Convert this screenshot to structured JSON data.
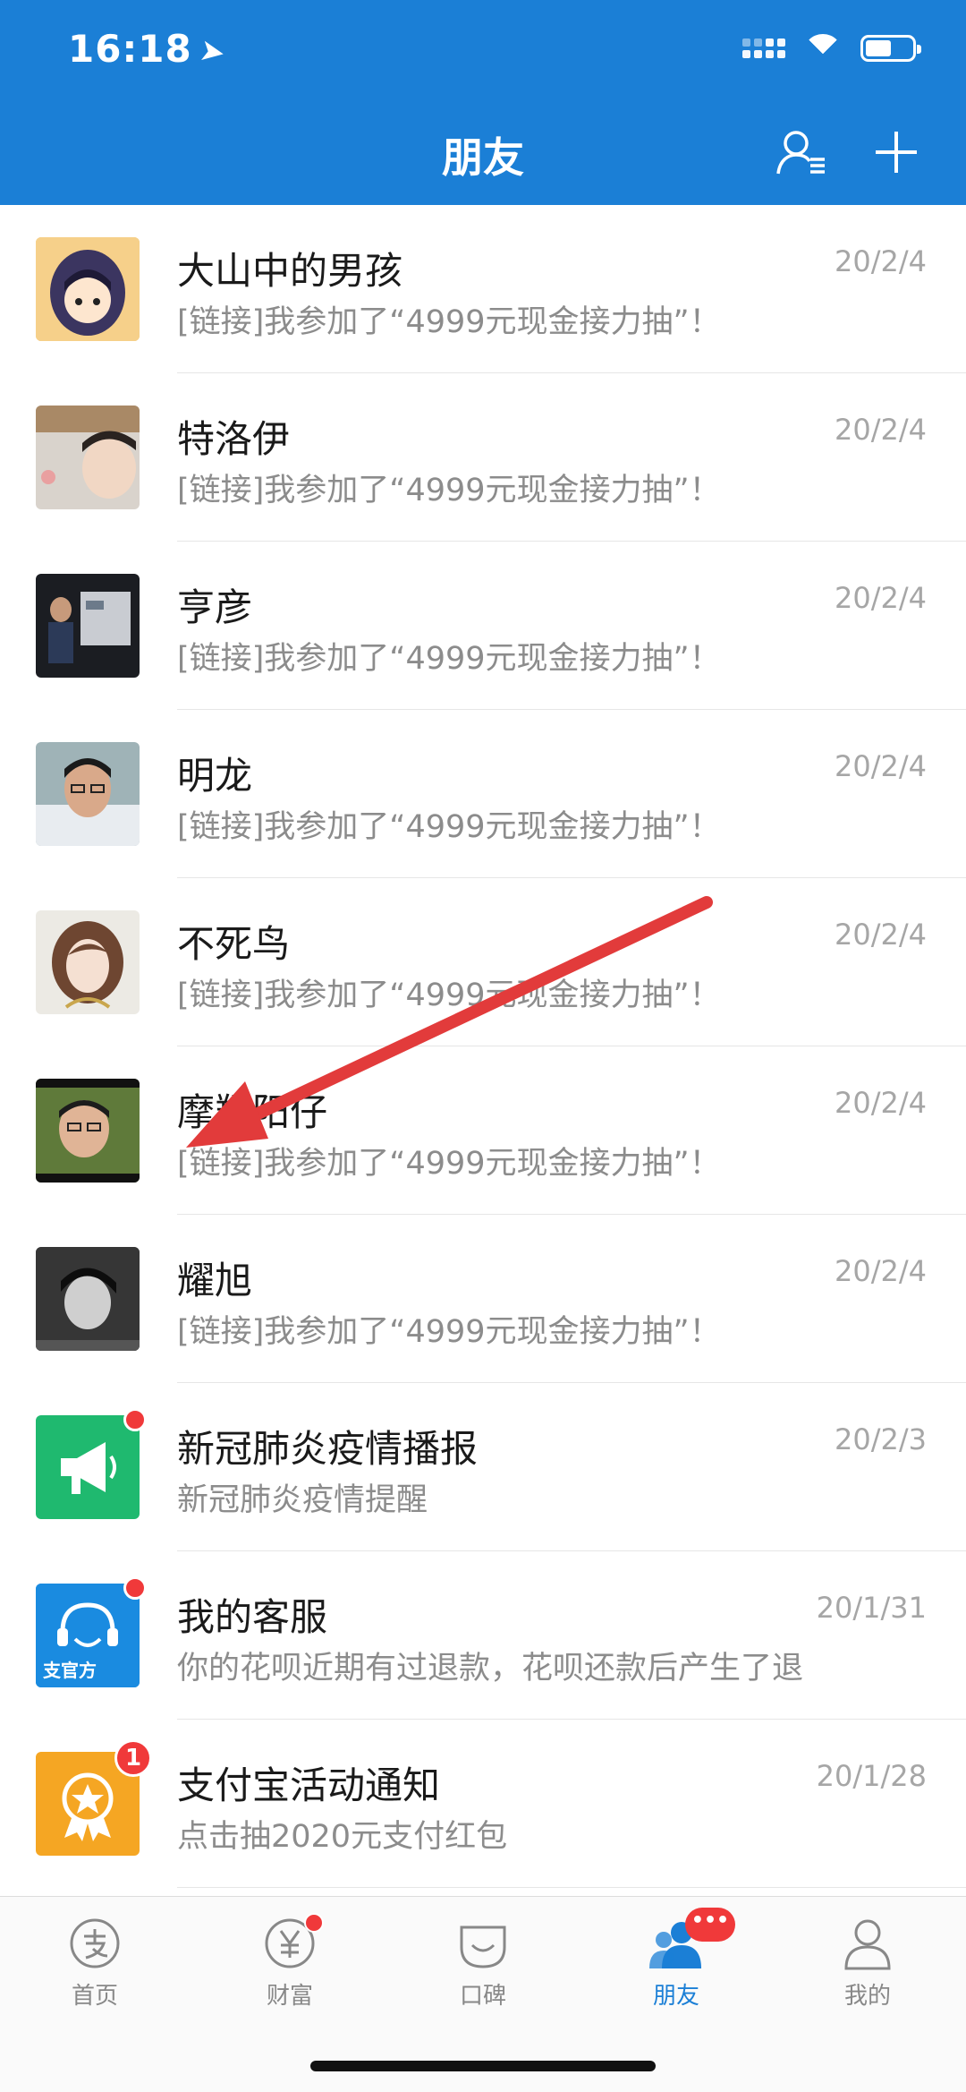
{
  "status": {
    "time": "16:18",
    "location_icon": "location-arrow-icon",
    "battery_level": 0.55
  },
  "header": {
    "title": "朋友",
    "contacts_icon": "contacts-icon",
    "add_icon": "plus-icon"
  },
  "conversations": [
    {
      "name": "大山中的男孩",
      "preview": "[链接]我参加了“4999元现金接力抽”！",
      "date": "20/2/4"
    },
    {
      "name": "特洛伊",
      "preview": "[链接]我参加了“4999元现金接力抽”！",
      "date": "20/2/4"
    },
    {
      "name": "亨彦",
      "preview": "[链接]我参加了“4999元现金接力抽”！",
      "date": "20/2/4"
    },
    {
      "name": "明龙",
      "preview": "[链接]我参加了“4999元现金接力抽”！",
      "date": "20/2/4"
    },
    {
      "name": "不死鸟",
      "preview": "[链接]我参加了“4999元现金接力抽”！",
      "date": "20/2/4"
    },
    {
      "name": "摩羯阳仔",
      "preview": "[链接]我参加了“4999元现金接力抽”！",
      "date": "20/2/4"
    },
    {
      "name": "耀旭",
      "preview": "[链接]我参加了“4999元现金接力抽”！",
      "date": "20/2/4"
    },
    {
      "name": "新冠肺炎疫情播报",
      "preview": "新冠肺炎疫情提醒",
      "date": "20/2/3"
    },
    {
      "name": "我的客服",
      "preview": "你的花呗近期有过退款，花呗还款后产生了退",
      "date": "20/1/31",
      "avatar_label": "支官方"
    },
    {
      "name": "支付宝活动通知",
      "preview": "点击抽2020元支付红包",
      "date": "20/1/28",
      "badge": "1"
    }
  ],
  "tabbar": {
    "tabs": [
      {
        "label": "首页",
        "icon": "alipay-home-icon"
      },
      {
        "label": "财富",
        "icon": "wealth-yuan-icon"
      },
      {
        "label": "口碑",
        "icon": "koubei-icon"
      },
      {
        "label": "朋友",
        "icon": "friends-icon",
        "badge": "•••"
      },
      {
        "label": "我的",
        "icon": "profile-icon"
      }
    ]
  },
  "colors": {
    "primary": "#1b7fd6",
    "badge": "#f0393a",
    "arrow": "#e23b3b"
  }
}
